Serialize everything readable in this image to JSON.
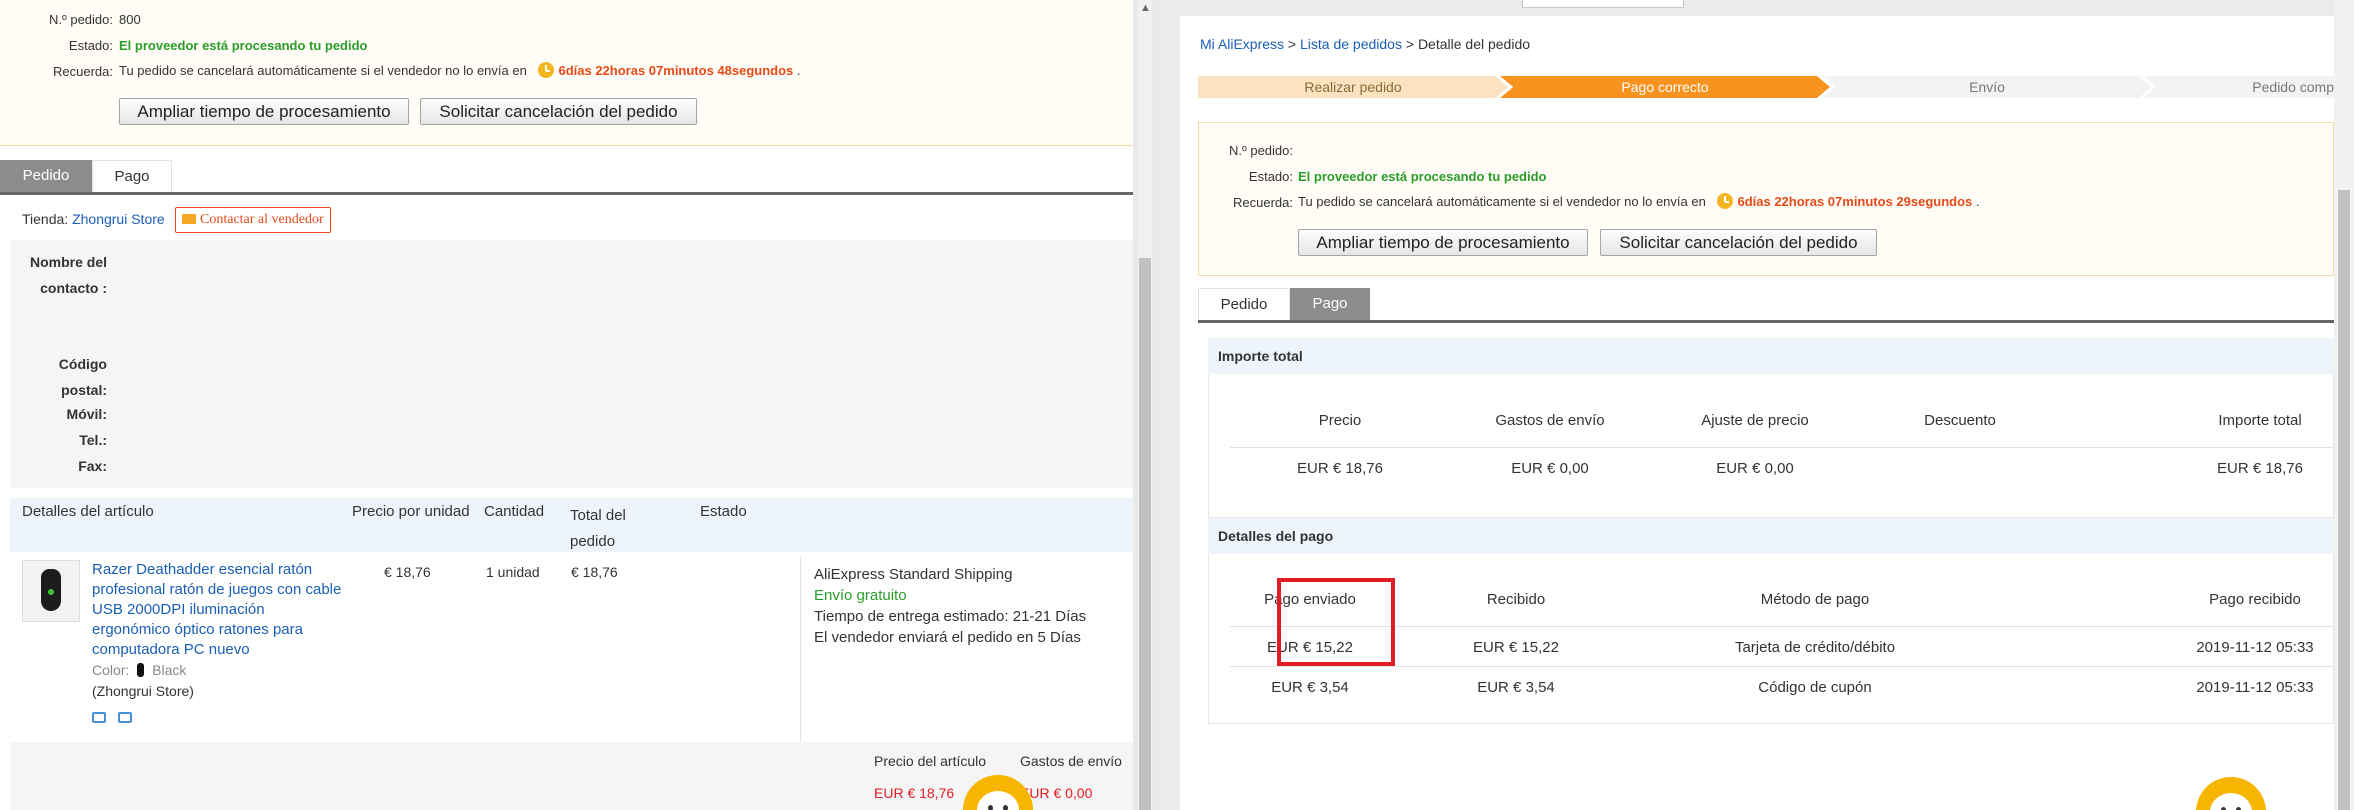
{
  "left": {
    "order": {
      "number_label": "N.º pedido:",
      "number_value": "800",
      "status_label": "Estado:",
      "status_value": "El proveedor está procesando tu pedido",
      "reminder_label": "Recuerda:",
      "reminder_text": "Tu pedido se cancelará automáticamente si el vendedor no lo envía en",
      "countdown": "6días 22horas 07minutos 48segundos",
      "period": "."
    },
    "buttons": {
      "extend": "Ampliar tiempo de procesamiento",
      "cancel": "Solicitar cancelación del pedido"
    },
    "tabs": [
      "Pedido",
      "Pago"
    ],
    "store": {
      "label": "Tienda:",
      "name": "Zhongrui Store",
      "contact": "Contactar al vendedor"
    },
    "contact_fields": {
      "name_l1": "Nombre del",
      "name_l2": "contacto :",
      "postal_l1": "Código",
      "postal_l2": "postal:",
      "mobile": "Móvil:",
      "phone": "Tel.:",
      "fax": "Fax:"
    },
    "items_table": {
      "headers": {
        "details": "Detalles del artículo",
        "unit_price": "Precio por unidad",
        "quantity": "Cantidad",
        "total_l1": "Total del",
        "total_l2": "pedido",
        "status": "Estado"
      },
      "item": {
        "title_lines": [
          "Razer Deathadder esencial ratón",
          "profesional ratón de juegos con cable",
          "USB 2000DPI iluminación",
          "ergonómico óptico ratones para",
          "computadora PC nuevo"
        ],
        "color_label": "Color:",
        "color_value": "Black",
        "store": "(Zhongrui Store)",
        "unit_price": "€ 18,76",
        "quantity": "1 unidad",
        "total": "€ 18,76"
      },
      "shipping": {
        "method": "AliExpress Standard Shipping",
        "free": "Envío gratuito",
        "delivery": "Tiempo de entrega estimado: 21-21 Días",
        "dispatch": "El vendedor enviará el pedido en 5 Días"
      }
    },
    "summary": {
      "item_price_label": "Precio del artículo",
      "shipping_label": "Gastos de envío",
      "item_price_value": "EUR € 18,76",
      "shipping_value": "EUR € 0,00"
    }
  },
  "right": {
    "breadcrumb": {
      "home": "Mi AliExpress",
      "sep1": ">",
      "list": "Lista de pedidos",
      "sep2": ">",
      "current": "Detalle del pedido"
    },
    "steps": [
      "Realizar pedido",
      "Pago correcto",
      "Envío",
      "Pedido comp"
    ],
    "order": {
      "number_label": "N.º pedido:",
      "status_label": "Estado:",
      "status_value": "El proveedor está procesando tu pedido",
      "reminder_label": "Recuerda:",
      "reminder_text": "Tu pedido se cancelará automáticamente si el vendedor no lo envía en",
      "countdown": "6días 22horas 07minutos 29segundos",
      "period": "."
    },
    "buttons": {
      "extend": "Ampliar tiempo de procesamiento",
      "cancel": "Solicitar cancelación del pedido"
    },
    "tabs": [
      "Pedido",
      "Pago"
    ],
    "total_section": {
      "title": "Importe total",
      "headers": [
        "Precio",
        "Gastos de envío",
        "Ajuste de precio",
        "Descuento",
        "Importe total"
      ],
      "row": [
        "EUR € 18,76",
        "EUR € 0,00",
        "EUR € 0,00",
        "",
        "EUR € 18,76"
      ]
    },
    "payment_section": {
      "title": "Detalles del pago",
      "headers": [
        "Pago enviado",
        "Recibido",
        "Método de pago",
        "Pago recibido"
      ],
      "rows": [
        [
          "EUR € 15,22",
          "EUR € 15,22",
          "Tarjeta de crédito/débito",
          "2019-11-12 05:33"
        ],
        [
          "EUR € 3,54",
          "EUR € 3,54",
          "Código de cupón",
          "2019-11-12 05:33"
        ]
      ]
    }
  },
  "colors": {
    "status_green": "#2a9d2a",
    "countdown_red": "#e64a19",
    "link_blue": "#1a5fb4",
    "step_active": "#f7931e",
    "step_done": "#fbe3c2",
    "highlight_red": "#e21b23"
  },
  "icons": [
    "clock-icon",
    "envelope-icon",
    "mouse-thumbnail",
    "robot-mascot-icon",
    "phone-icon",
    "document-icon"
  ]
}
